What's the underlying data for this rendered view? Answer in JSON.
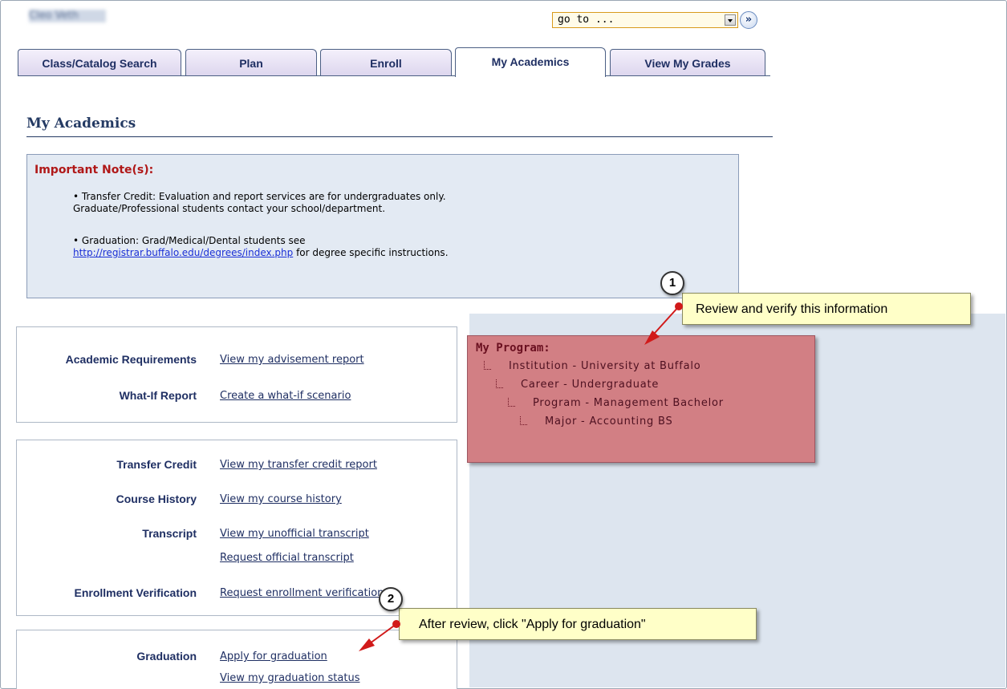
{
  "header": {
    "user_name": "Cleo Veth",
    "goto_value": "go to ...",
    "goto_button_glyph": "»"
  },
  "tabs": [
    {
      "label": "Class/Catalog Search"
    },
    {
      "label": "Plan"
    },
    {
      "label": "Enroll"
    },
    {
      "label": "My Academics",
      "active": true
    },
    {
      "label": "View My Grades"
    }
  ],
  "page_title": "My Academics",
  "notes": {
    "heading": "Important Note(s):",
    "note1_line1": "• Transfer Credit: Evaluation and report services are for undergraduates only.",
    "note1_line2": "Graduate/Professional students contact your school/department.",
    "note2_line1": "• Graduation: Grad/Medical/Dental students see",
    "note2_link": "http://registrar.buffalo.edu/degrees/index.php",
    "note2_rest": " for degree specific instructions."
  },
  "sections": {
    "academic_requirements": {
      "label": "Academic Requirements",
      "link": "View my advisement report"
    },
    "what_if": {
      "label": "What-If Report",
      "link": "Create a what-if scenario"
    },
    "transfer_credit": {
      "label": "Transfer Credit",
      "link": "View my transfer credit report"
    },
    "course_history": {
      "label": "Course History",
      "link": "View my course history"
    },
    "transcript": {
      "label": "Transcript",
      "link": "View my unofficial transcript",
      "link2": "Request official transcript"
    },
    "enrollment_verification": {
      "label": "Enrollment Verification",
      "link": "Request enrollment verification"
    },
    "graduation": {
      "label": "Graduation",
      "link": "Apply for graduation",
      "link2": "View my graduation status"
    }
  },
  "program": {
    "heading": "My Program:",
    "institution": "Institution - University at Buffalo",
    "career": "Career - Undergraduate",
    "program": "Program - Management Bachelor",
    "major": "Major - Accounting BS"
  },
  "callouts": {
    "c1_number": "1",
    "c1_text": "Review and verify this information",
    "c2_number": "2",
    "c2_text": "After review, click \"Apply for graduation\""
  },
  "colors": {
    "tab_text": "#1f2f63",
    "notes_heading": "#b01818",
    "program_highlight": "#d27f84",
    "callout_bg": "#ffffc8",
    "arrow": "#d11a1a"
  }
}
